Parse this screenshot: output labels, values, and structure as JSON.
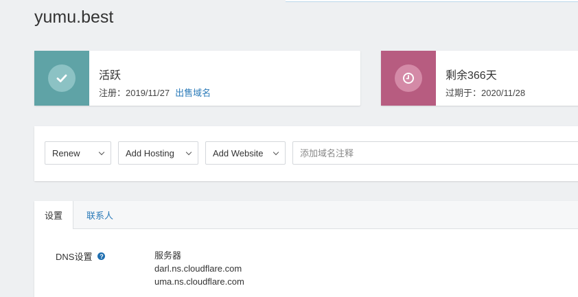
{
  "page": {
    "domain": "yumu.best"
  },
  "status_card": {
    "title": "活跃",
    "registered_label": "注册：2019/11/27",
    "sell_link": "出售域名",
    "icon": "check-icon",
    "color": "#5fa3a6"
  },
  "expiry_card": {
    "title": "剩余366天",
    "expires_label": "过期于：2020/11/28",
    "icon": "clock-icon",
    "color": "#b75c80"
  },
  "toolbar": {
    "renew": "Renew",
    "add_hosting": "Add Hosting",
    "add_website": "Add Website",
    "note_placeholder": "添加域名注释"
  },
  "tabs": [
    {
      "label": "设置",
      "active": true
    },
    {
      "label": "联系人",
      "active": false
    }
  ],
  "dns": {
    "label": "DNS设置",
    "heading": "服务器",
    "servers": [
      "darl.ns.cloudflare.com",
      "uma.ns.cloudflare.com"
    ]
  }
}
